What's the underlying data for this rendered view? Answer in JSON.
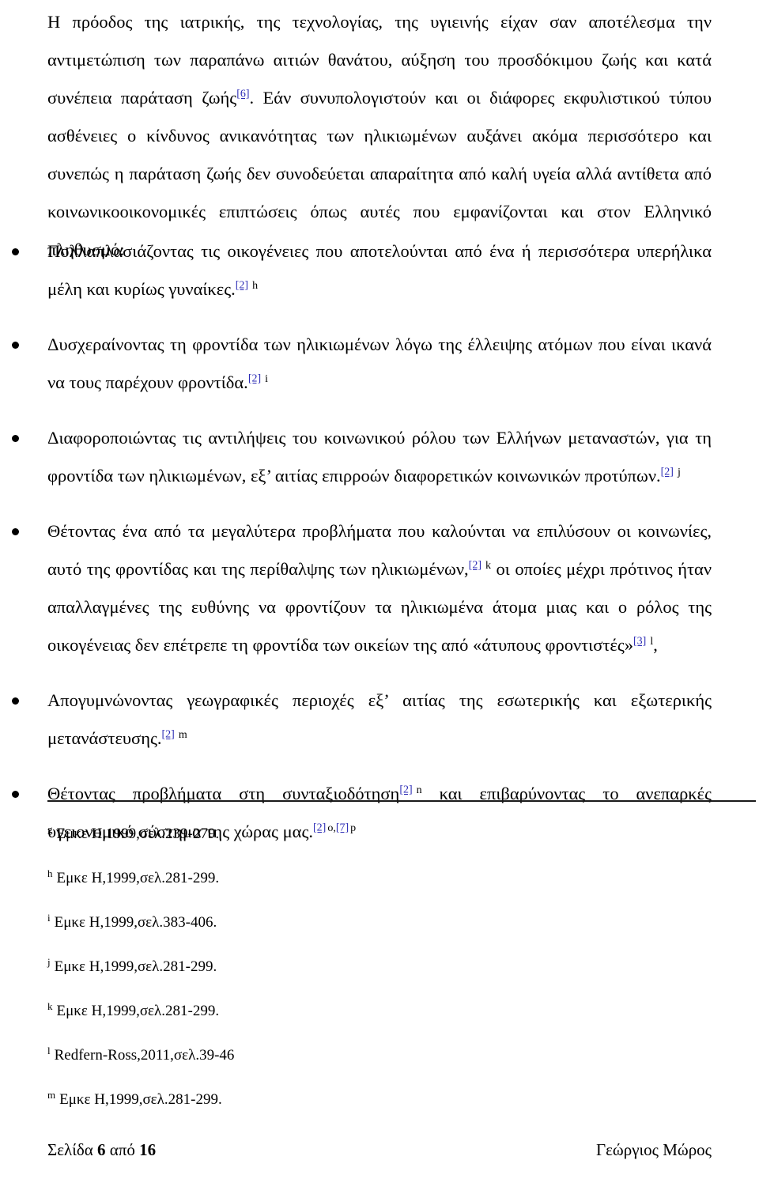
{
  "document": {
    "language": "el",
    "paragraphs": [
      {
        "id": "intro",
        "segments": [
          {
            "type": "text",
            "value": "Η πρόοδος της ιατρικής, της τεχνολογίας, της υγιεινής είχαν σαν αποτέλεσμα την αντιμετώπιση των παραπάνω αιτιών θανάτου, αύξηση του προσδόκιμου ζωής και κατά συνέπεια παράταση ζωής"
          },
          {
            "type": "ref",
            "value": "[6]"
          },
          {
            "type": "text",
            "value": ". Εάν συνυπολογιστούν και οι διάφορες εκφυλιστικού τύπου ασθένειες ο κίνδυνος ανικανότητας των ηλικιωμένων αυξάνει ακόμα περισσότερο και συνεπώς η παράταση ζωής δεν συνοδεύεται απαραίτητα από καλή υγεία αλλά αντίθετα από κοινωνικοοικονομικές επιπτώσεις όπως αυτές που εμφανίζονται και στον Ελληνικό πληθυσμό:"
          }
        ]
      }
    ],
    "bullets": [
      {
        "id": "bullet-h",
        "text": "Πολλαπλασιάζοντας τις οικογένειες που αποτελούνται από ένα ή περισσότερα υπερήλικα μέλη και κυρίως γυναίκες.",
        "ref": "[2]",
        "mark": "h"
      },
      {
        "id": "bullet-i",
        "text": "Δυσχεραίνοντας τη φροντίδα των ηλικιωμένων λόγω της έλλειψης ατόμων που είναι ικανά να τους παρέχουν φροντίδα.",
        "ref": "[2]",
        "mark": "i"
      },
      {
        "id": "bullet-j",
        "text": "Διαφοροποιώντας τις αντιλήψεις του κοινωνικού ρόλου των Ελλήνων μεταναστών, για τη φροντίδα των ηλικιωμένων, εξ’ αιτίας επιρροών διαφορετικών κοινωνικών προτύπων.",
        "ref": "[2]",
        "mark": "j"
      },
      {
        "id": "bullet-k-l",
        "text_part1": "Θέτοντας ένα από τα μεγαλύτερα προβλήματα που καλούνται να επιλύσουν οι κοινωνίες, αυτό της φροντίδας και της περίθαλψης των ηλικιωμένων,",
        "ref1": "[2]",
        "mark1": "k",
        "text_part2": "οι οποίες μέχρι πρότινος ήταν απαλλαγμένες της ευθύνης να φροντίζουν τα ηλικιωμένα άτομα μιας και ο ρόλος της οικογένειας δεν επέτρεπε τη φροντίδα των οικείων της από «άτυπους φροντιστές»",
        "ref2": "[3]",
        "mark2": "l",
        "text_part3": ","
      },
      {
        "id": "bullet-m",
        "text": "Απογυμνώνοντας γεωγραφικές περιοχές εξ’ αιτίας της εσωτερικής και εξωτερικής μετανάστευσης.",
        "ref": "[2]",
        "mark": "m"
      },
      {
        "id": "bullet-n-p",
        "text_part1": "Θέτοντας προβλήματα στη συνταξιοδότηση",
        "ref1": "[2]",
        "mark1": "n",
        "text_part2": "και επιβαρύνοντας το ανεπαρκές υγειονομικό σύστημα της χώρας μας.",
        "ref2": "[2]",
        "mark2": "o,",
        "ref3": "[7]",
        "mark3": "p"
      }
    ],
    "footnotes": [
      {
        "mark": "g",
        "text": "Εμκε Η,1999,σελ.239-279."
      },
      {
        "mark": "h",
        "text": "Εμκε Η,1999,σελ.281-299."
      },
      {
        "mark": "i",
        "text": "Εμκε Η,1999,σελ.383-406."
      },
      {
        "mark": "j",
        "text": "Εμκε Η,1999,σελ.281-299."
      },
      {
        "mark": "k",
        "text": "Εμκε Η,1999,σελ.281-299."
      },
      {
        "mark": "l",
        "text": "Redfern-Ross,2011,σελ.39-46"
      },
      {
        "mark": "m",
        "text": "Εμκε Η,1999,σελ.281-299."
      }
    ],
    "footer": {
      "page_label_prefix": "Σελίδα",
      "page_number": "6",
      "page_label_middle": "από",
      "page_total": "16",
      "author": "Γεώργιος Μώρος"
    },
    "colors": {
      "link": "#2b2bb5",
      "text": "#000000",
      "background": "#ffffff",
      "rule": "#1a1a1a"
    }
  }
}
